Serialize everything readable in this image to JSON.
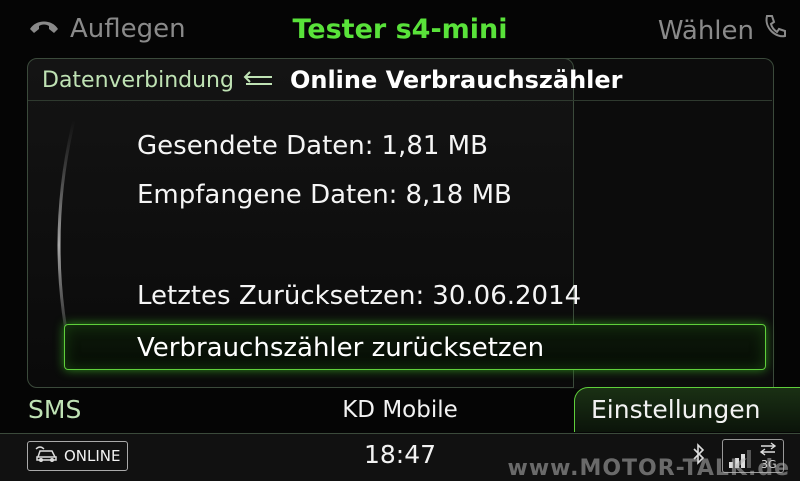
{
  "header": {
    "hangup_label": "Auflegen",
    "title": "Tester s4-mini",
    "dial_label": "Wählen"
  },
  "breadcrumb": {
    "parent": "Datenverbindung",
    "current": "Online Verbrauchszähler"
  },
  "stats": {
    "sent_label": "Gesendete Daten:",
    "sent_value": "1,81 MB",
    "received_label": "Empfangene Daten:",
    "received_value": "8,18 MB",
    "reset_date_label": "Letztes Zurücksetzen:",
    "reset_date_value": "30.06.2014"
  },
  "reset_button": {
    "label": "Verbrauchszähler zurücksetzen"
  },
  "tabs": {
    "left": "SMS",
    "center": "KD Mobile",
    "right": "Einstellungen"
  },
  "status": {
    "online_badge": "ONLINE",
    "time": "18:47",
    "network": "3G",
    "watermark": "www.MOTOR-TALK.de"
  },
  "colors": {
    "accent_green": "#59e23a",
    "highlight_border": "#5fcf3b",
    "muted_text": "#8a8a8a"
  },
  "icons": [
    "hangup-phone-icon",
    "phone-icon",
    "back-arrow-icon",
    "car-online-icon",
    "bluetooth-icon",
    "signal-strength-icon"
  ]
}
